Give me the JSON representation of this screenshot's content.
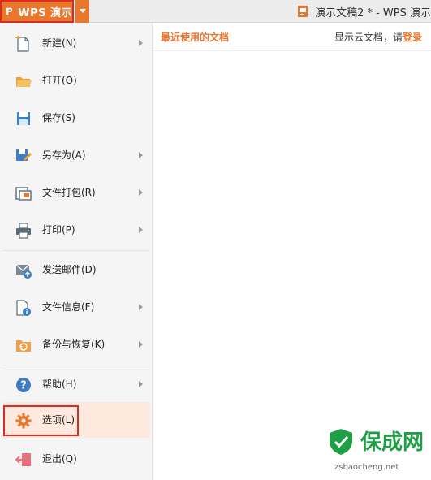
{
  "titlebar": {
    "app_button_label": "WPS 演示",
    "document_title": "演示文稿2 * - WPS 演示",
    "accent_color": "#e9772e"
  },
  "menu": {
    "items": [
      {
        "label": "新建(N)",
        "icon": "new-doc-icon",
        "has_submenu": true
      },
      {
        "label": "打开(O)",
        "icon": "open-folder-icon",
        "has_submenu": false
      },
      {
        "label": "保存(S)",
        "icon": "save-disk-icon",
        "has_submenu": false
      },
      {
        "label": "另存为(A)",
        "icon": "save-as-icon",
        "has_submenu": true
      },
      {
        "label": "文件打包(R)",
        "icon": "package-icon",
        "has_submenu": true
      },
      {
        "label": "打印(P)",
        "icon": "printer-icon",
        "has_submenu": true
      },
      {
        "label": "发送邮件(D)",
        "icon": "mail-icon",
        "has_submenu": false
      },
      {
        "label": "文件信息(F)",
        "icon": "file-info-icon",
        "has_submenu": true
      },
      {
        "label": "备份与恢复(K)",
        "icon": "backup-icon",
        "has_submenu": true
      },
      {
        "label": "帮助(H)",
        "icon": "help-icon",
        "has_submenu": true
      },
      {
        "label": "选项(L)",
        "icon": "gear-icon",
        "has_submenu": false,
        "selected": true
      },
      {
        "label": "退出(Q)",
        "icon": "exit-icon",
        "has_submenu": false
      }
    ]
  },
  "panel": {
    "recent_title": "最近使用的文档",
    "cloud_prefix": "显示云文档，请",
    "cloud_login": "登录"
  },
  "watermark": {
    "title": "保成网",
    "url": "zsbaocheng.net"
  }
}
